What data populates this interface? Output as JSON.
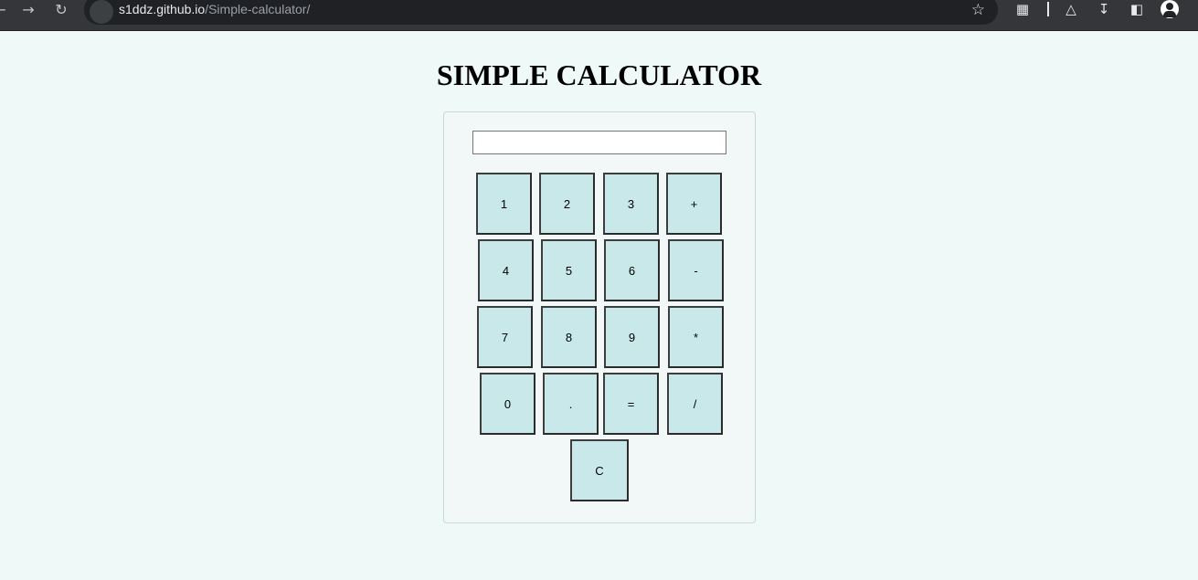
{
  "browser": {
    "url_host": "s1ddz.github.io",
    "url_path": "/Simple-calculator/",
    "back_icon": "arrow-left-icon",
    "forward_icon": "arrow-right-icon",
    "reload_icon": "reload-icon",
    "star_icon": "star-icon",
    "toolbar_icons": [
      "extensions-icon",
      "labs-icon",
      "download-icon",
      "sidepanel-icon",
      "profile-icon"
    ]
  },
  "page": {
    "title": "SIMPLE CALCULATOR",
    "display_value": ""
  },
  "keys": {
    "k1": "1",
    "k2": "2",
    "k3": "3",
    "plus": "+",
    "k4": "4",
    "k5": "5",
    "k6": "6",
    "minus": "-",
    "k7": "7",
    "k8": "8",
    "k9": "9",
    "times": "*",
    "k0": "0",
    "dot": ".",
    "equals": "=",
    "divide": "/",
    "clear": "C"
  },
  "colors": {
    "page_bg": "#eff9f8",
    "key_bg": "#c8e8ea",
    "chrome_bg": "#35363a"
  }
}
